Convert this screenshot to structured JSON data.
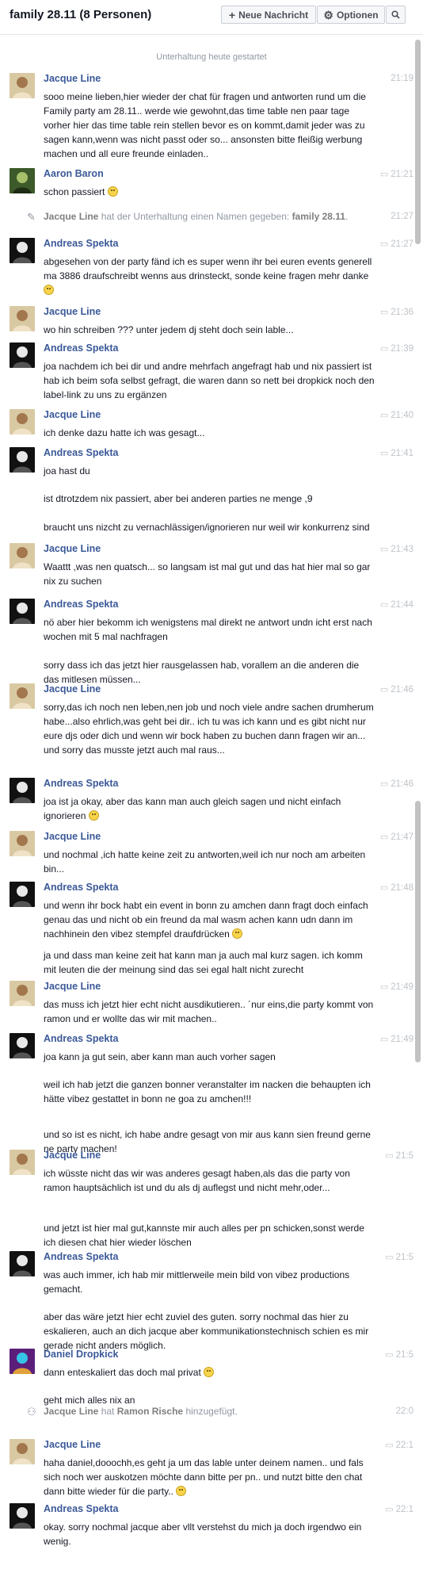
{
  "header": {
    "title": "family 28.11 (8 Personen)",
    "new_message_label": "Neue Nachricht",
    "options_label": "Optionen"
  },
  "thread": {
    "started_label": "Unterhaltung heute gestartet",
    "messages": [
      {
        "name": "Jacque Line",
        "time": "21:19",
        "paras": [
          "sooo meine lieben,hier wieder der chat für fragen und antworten rund um die Family party am 28.11.. werde wie gewohnt,das time table nen paar tage vorher hier das time table rein stellen bevor es on kommt,damit jeder was zu sagen kann,wenn was nicht passt oder so... ansonsten bitte fleißig werbung machen und all eure freunde einladen.."
        ]
      },
      {
        "name": "Aaron Baron",
        "time": "21:21",
        "paras": [
          "schon passiert"
        ]
      },
      {
        "name": "Andreas Spekta",
        "time": "21:27",
        "paras": [
          "abgesehen von der party fänd ich es super wenn ihr bei euren events generell ma 3886 draufschreibt wenns aus drinsteckt, sonde keine fragen mehr danke"
        ]
      },
      {
        "name": "Jacque Line",
        "time": "21:36",
        "paras": [
          "wo hin schreiben ??? unter jedem dj steht doch sein lable..."
        ]
      },
      {
        "name": "Andreas Spekta",
        "time": "21:39",
        "paras": [
          "joa nachdem ich bei dir und andre mehrfach angefragt hab und nix passiert ist hab ich beim sofa selbst gefragt, die waren dann so nett bei dropkick noch den label-link zu uns zu ergänzen"
        ]
      },
      {
        "name": "Jacque Line",
        "time": "21:40",
        "paras": [
          "ich denke dazu hatte ich was gesagt..."
        ]
      },
      {
        "name": "Andreas Spekta",
        "time": "21:41",
        "paras": [
          "joa hast du",
          "ist dtrotzdem nix passiert, aber bei anderen parties ne menge ,9",
          "braucht uns nizcht zu vernachlässigen/ignorieren nur weil wir konkurrenz sind"
        ]
      },
      {
        "name": "Jacque Line",
        "time": "21:43",
        "paras": [
          "Waattt ,was nen quatsch... so langsam ist mal gut und das hat hier mal so gar nix zu suchen"
        ]
      },
      {
        "name": "Andreas Spekta",
        "time": "21:44",
        "paras": [
          "nö aber hier bekomm ich wenigstens mal direkt ne antwort undn icht erst nach wochen mit 5 mal nachfragen",
          "sorry dass ich das jetzt hier rausgelassen hab, vorallem an die anderen die das mitlesen müssen..."
        ]
      },
      {
        "name": "Jacque Line",
        "time": "21:46",
        "paras": [
          "sorry,das ich noch nen leben,nen job und noch viele andre sachen drumherum habe...also ehrlich,was geht bei dir.. ich tu was ich kann und es gibt nicht nur eure djs oder dich und wenn wir bock haben zu buchen dann fragen wir an... und sorry das musste jetzt auch mal raus..."
        ]
      },
      {
        "name": "Andreas Spekta",
        "time": "21:46",
        "paras": [
          "joa ist ja okay, aber das kann man auch gleich sagen und nicht einfach ignorieren"
        ]
      },
      {
        "name": "Jacque Line",
        "time": "21:47",
        "paras": [
          "und nochmal ,ich hatte keine zeit zu antworten,weil ich nur noch am arbeiten bin..."
        ]
      },
      {
        "name": "Andreas Spekta",
        "time": "21:48",
        "paras": [
          "und wenn ihr bock habt ein event in bonn zu amchen dann fragt doch einfach genau das und nicht ob ein freund da mal wasm achen kann udn dann im nachhinein den vibez stempfel draufdrücken",
          "ja und dass man keine zeit hat kann man ja auch mal kurz sagen. ich komm mit leuten die der meinung sind das sei egal halt nicht zurecht"
        ]
      },
      {
        "name": "Jacque Line",
        "time": "21:49",
        "paras": [
          "das muss ich jetzt hier echt nicht ausdikutieren.. ´nur eins,die party kommt von ramon und er wollte das wir mit machen.."
        ]
      },
      {
        "name": "Andreas Spekta",
        "time": "21:49",
        "paras": [
          "joa kann ja gut sein, aber kann man auch vorher sagen",
          "weil ich hab jetzt die ganzen bonner veranstalter im nacken die behaupten ich hätte vibez gestattet in bonn ne goa zu amchen!!!",
          "und so ist es nicht, ich habe andre gesagt von mir aus kann sien freund gerne ne party machen!"
        ]
      },
      {
        "name": "Jacque Line",
        "time": "21:5",
        "paras": [
          "ich wüsste nicht das wir was anderes gesagt haben,als das die party von ramon hauptsächlich ist und du als dj auflegst und nicht mehr,oder...",
          "und jetzt ist hier mal gut,kannste mir auch alles per pn schicken,sonst werde ich diesen chat hier wieder löschen"
        ]
      },
      {
        "name": "Andreas Spekta",
        "time": "21:5",
        "paras": [
          "was auch immer, ich hab mir mittlerweile mein bild von vibez productions gemacht.",
          "aber das wäre jetzt hier echt zuviel des guten. sorry nochmal das hier zu eskalieren, auch an dich jacque aber kommunikationstechnisch schien es mir gerade nicht anders möglich."
        ]
      },
      {
        "name": "Daniel Dropkick",
        "time": "21:5",
        "paras": [
          "dann enteskaliert das doch mal privat",
          "geht mich alles nix an"
        ]
      },
      {
        "name": "Jacque Line",
        "time": "22:1",
        "paras": [
          "haha daniel,dooochh,es geht ja um das lable unter deinem namen.. und fals sich noch wer auskotzen möchte dann bitte per pn.. und nutzt bitte den chat dann bitte wieder für die party.."
        ]
      },
      {
        "name": "Andreas Spekta",
        "time": "22:1",
        "paras": [
          "okay. sorry nochmal jacque aber vllt verstehst du mich ja doch irgendwo ein wenig."
        ]
      }
    ],
    "events": [
      {
        "actor": "Jacque Line",
        "verb": "hat der Unterhaltung einen Namen gegeben:",
        "object": "family 28.11",
        "suffix": ".",
        "time": "21:27"
      },
      {
        "actor": "Jacque Line",
        "verb": "hat",
        "object": "Ramon Rische",
        "suffix": "hinzugefügt.",
        "time": "22:0"
      }
    ]
  }
}
